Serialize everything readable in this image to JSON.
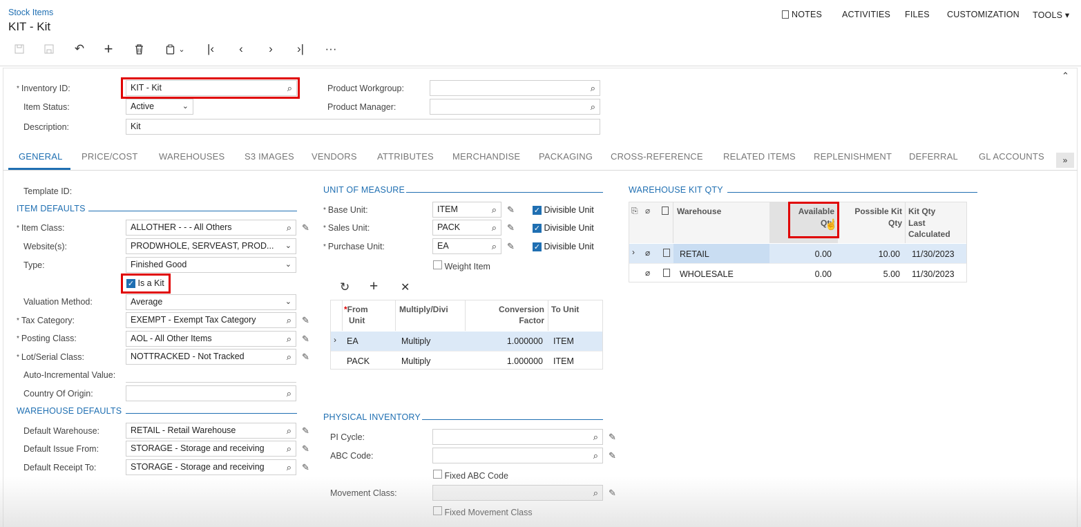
{
  "header": {
    "breadcrumb": "Stock Items",
    "title": "KIT - Kit",
    "menu": {
      "notes": "NOTES",
      "activities": "ACTIVITIES",
      "files": "FILES",
      "customization": "CUSTOMIZATION",
      "tools": "TOOLS"
    }
  },
  "toolbar": {
    "icons": [
      "save-close-icon",
      "save-icon",
      "undo-icon",
      "add-icon",
      "delete-icon",
      "clipboard-icon",
      "first-icon",
      "prev-icon",
      "next-icon",
      "last-icon",
      "more-icon"
    ]
  },
  "summary": {
    "inventory_id": {
      "label": "Inventory ID:",
      "value": "KIT - Kit"
    },
    "item_status": {
      "label": "Item Status:",
      "value": "Active"
    },
    "description": {
      "label": "Description:",
      "value": "Kit"
    },
    "product_workgroup": {
      "label": "Product Workgroup:",
      "value": ""
    },
    "product_manager": {
      "label": "Product Manager:",
      "value": ""
    }
  },
  "tabs": [
    "GENERAL",
    "PRICE/COST",
    "WAREHOUSES",
    "S3 IMAGES",
    "VENDORS",
    "ATTRIBUTES",
    "MERCHANDISE",
    "PACKAGING",
    "CROSS-REFERENCE",
    "RELATED ITEMS",
    "REPLENISHMENT",
    "DEFERRAL",
    "GL ACCOUNTS"
  ],
  "general": {
    "template_id": {
      "label": "Template ID:"
    },
    "item_defaults_title": "ITEM DEFAULTS",
    "item_class": {
      "label": "Item Class:",
      "value": "ALLOTHER  -   - - All Others"
    },
    "websites": {
      "label": "Website(s):",
      "value": "PRODWHOLE, SERVEAST, PROD..."
    },
    "type": {
      "label": "Type:",
      "value": "Finished Good"
    },
    "is_a_kit": {
      "label": "Is a Kit",
      "checked": true
    },
    "valuation_method": {
      "label": "Valuation Method:",
      "value": "Average"
    },
    "tax_category": {
      "label": "Tax Category:",
      "value": "EXEMPT - Exempt Tax Category"
    },
    "posting_class": {
      "label": "Posting Class:",
      "value": "AOL - All Other Items"
    },
    "lot_serial_class": {
      "label": "Lot/Serial Class:",
      "value": "NOTTRACKED - Not Tracked"
    },
    "auto_incremental": {
      "label": "Auto-Incremental Value:"
    },
    "country_of_origin": {
      "label": "Country Of Origin:",
      "value": ""
    },
    "warehouse_defaults_title": "WAREHOUSE DEFAULTS",
    "default_warehouse": {
      "label": "Default Warehouse:",
      "value": "RETAIL - Retail Warehouse"
    },
    "default_issue_from": {
      "label": "Default Issue From:",
      "value": "STORAGE - Storage and receiving"
    },
    "default_receipt_to": {
      "label": "Default Receipt To:",
      "value": "STORAGE - Storage and receiving"
    }
  },
  "uom": {
    "title": "UNIT OF MEASURE",
    "base_unit": {
      "label": "Base Unit:",
      "value": "ITEM"
    },
    "sales_unit": {
      "label": "Sales Unit:",
      "value": "PACK"
    },
    "purchase_unit": {
      "label": "Purchase Unit:",
      "value": "EA"
    },
    "divisible_label": "Divisible Unit",
    "weight_item": "Weight Item",
    "grid": {
      "headers": {
        "from_unit_1": "From",
        "from_unit_2": "Unit",
        "multiply": "Multiply/Divi",
        "conv_1": "Conversion",
        "conv_2": "Factor",
        "to_unit": "To Unit"
      },
      "rows": [
        {
          "from": "EA",
          "op": "Multiply",
          "factor": "1.000000",
          "to": "ITEM"
        },
        {
          "from": "PACK",
          "op": "Multiply",
          "factor": "1.000000",
          "to": "ITEM"
        }
      ]
    }
  },
  "physical": {
    "title": "PHYSICAL INVENTORY",
    "pi_cycle": {
      "label": "PI Cycle:",
      "value": ""
    },
    "abc_code": {
      "label": "ABC Code:",
      "value": ""
    },
    "fixed_abc": "Fixed ABC Code",
    "movement_class": {
      "label": "Movement Class:",
      "value": ""
    },
    "fixed_movement": "Fixed Movement Class"
  },
  "kit_qty": {
    "title": "WAREHOUSE KIT QTY",
    "headers": {
      "warehouse": "Warehouse",
      "avail_1": "Available",
      "avail_2": "Qty",
      "possible_1": "Possible Kit",
      "possible_2": "Qty",
      "last_1": "Kit Qty",
      "last_2": "Last",
      "last_3": "Calculated"
    },
    "rows": [
      {
        "warehouse": "RETAIL",
        "available": "0.00",
        "possible": "10.00",
        "date": "11/30/2023"
      },
      {
        "warehouse": "WHOLESALE",
        "available": "0.00",
        "possible": "5.00",
        "date": "11/30/2023"
      }
    ]
  },
  "colors": {
    "accent": "#1f6fb2",
    "highlight": "#e00000",
    "selected_row": "#dce9f7"
  }
}
